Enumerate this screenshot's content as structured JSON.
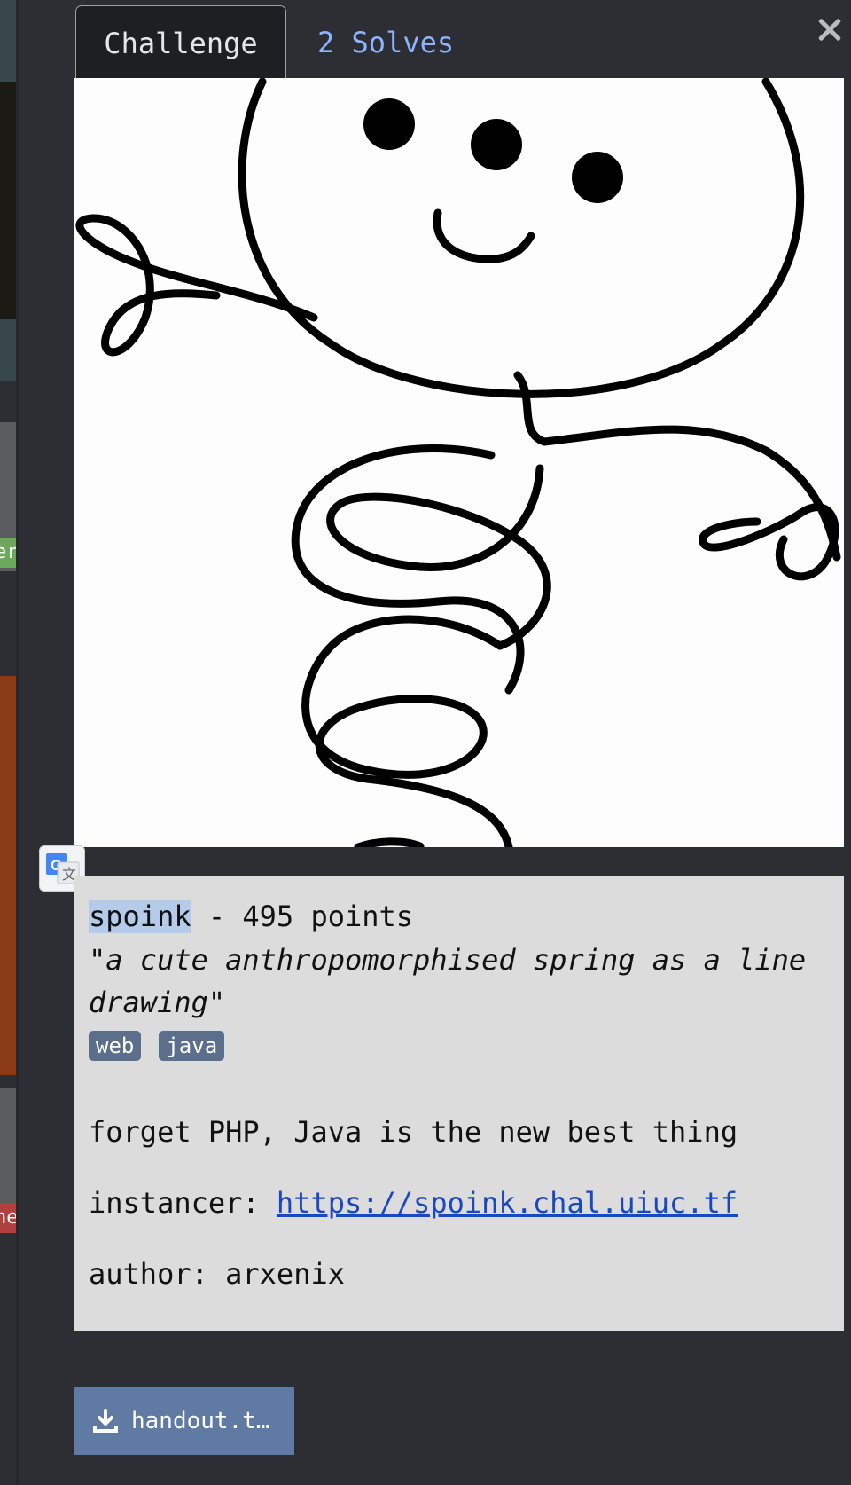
{
  "tabs": {
    "challenge_label": "Challenge",
    "solves_label": "2 Solves"
  },
  "background": {
    "partial_tag_1": "er",
    "partial_tag_2": "ne"
  },
  "challenge": {
    "name": "spoink",
    "points_text": " - 495 points",
    "quote": "\"a cute anthropomorphised spring as a line drawing\"",
    "tags": [
      "web",
      "java"
    ],
    "description": "forget PHP, Java is the new best thing",
    "instancer_label": "instancer: ",
    "instancer_url": "https://spoink.chal.uiuc.tf",
    "author_label": "author: arxenix"
  },
  "download": {
    "label": "handout.t…"
  },
  "colors": {
    "modal_bg": "#2c2e33",
    "tab_link": "#8cb4ff",
    "desc_bg": "#dcdcdc",
    "tag_bg": "#5b6e8c",
    "button_bg": "#5f7aa3"
  },
  "icons": [
    "close-icon",
    "translate-icon",
    "download-icon"
  ]
}
